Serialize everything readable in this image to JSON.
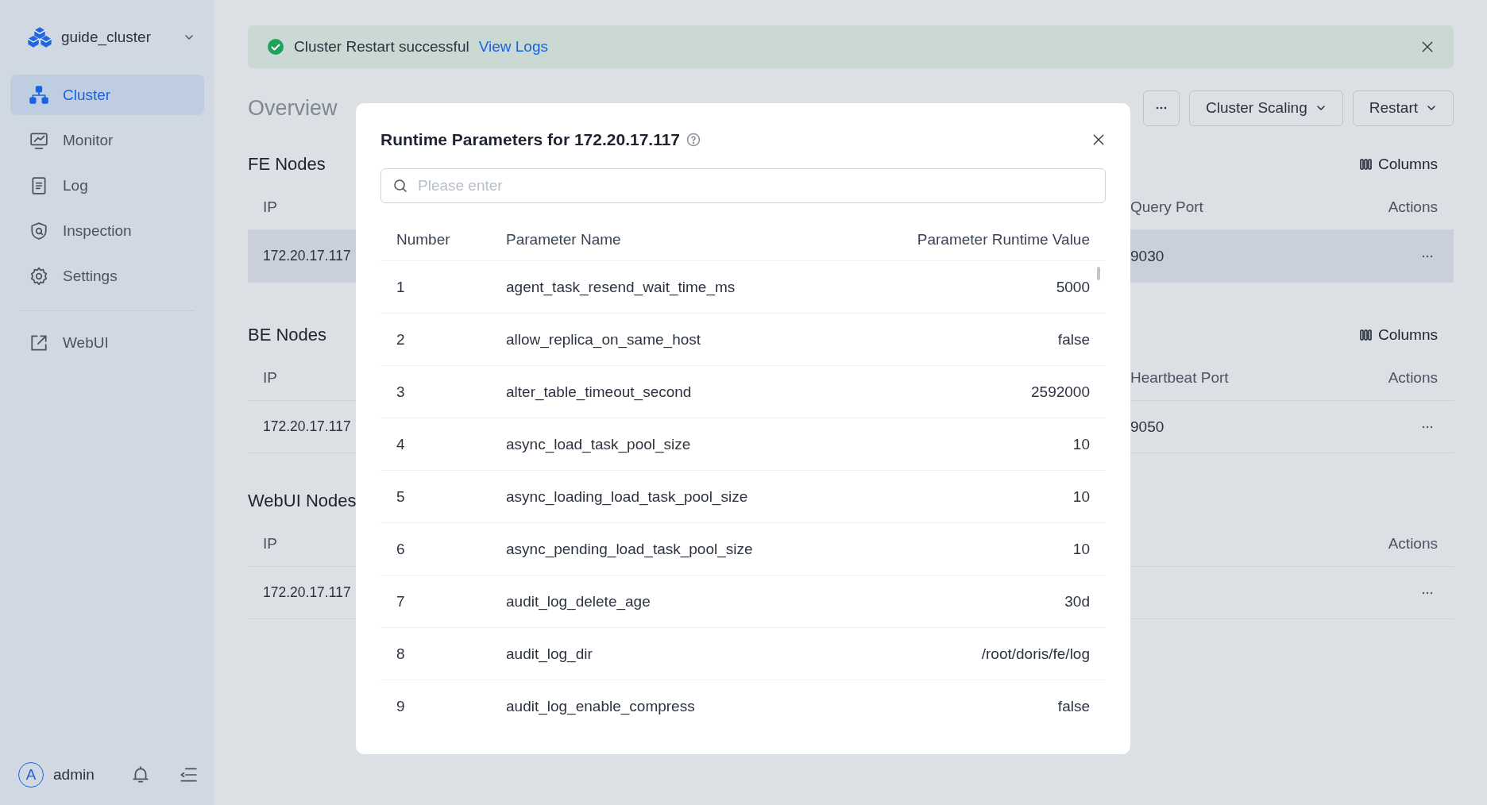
{
  "sidebar": {
    "cluster_name": "guide_cluster",
    "items": [
      {
        "label": "Cluster",
        "selected": true
      },
      {
        "label": "Monitor",
        "selected": false
      },
      {
        "label": "Log",
        "selected": false
      },
      {
        "label": "Inspection",
        "selected": false
      },
      {
        "label": "Settings",
        "selected": false
      }
    ],
    "links": [
      {
        "label": "WebUI"
      }
    ],
    "user": {
      "avatar": "A",
      "name": "admin"
    }
  },
  "notification": {
    "message": "Cluster Restart successful",
    "link": "View Logs"
  },
  "tabs": [
    {
      "label": "Overview",
      "selected": false
    }
  ],
  "toolbar": [
    {
      "kind": "more"
    },
    {
      "kind": "dropdown",
      "label": "Cluster Scaling"
    },
    {
      "kind": "dropdown",
      "label": "Restart"
    }
  ],
  "sections": [
    {
      "title": "FE Nodes",
      "columns_button": "Columns",
      "columns": [
        "IP",
        "Query Port",
        "Actions"
      ],
      "rows": [
        {
          "cells": [
            "172.20.17.117",
            "9030"
          ],
          "hovered": true
        }
      ]
    },
    {
      "title": "BE Nodes",
      "columns_button": "Columns",
      "columns": [
        "IP",
        "Heartbeat Port",
        "Actions"
      ],
      "rows": [
        {
          "cells": [
            "172.20.17.117",
            "9050"
          ],
          "hovered": false
        }
      ]
    },
    {
      "title": "WebUI Nodes",
      "columns": [
        "IP",
        "Actions"
      ],
      "rows": [
        {
          "cells": [
            "172.20.17.117"
          ],
          "hovered": false
        }
      ]
    }
  ],
  "modal": {
    "title": "Runtime Parameters for 172.20.17.117",
    "search": {
      "placeholder": "Please enter"
    },
    "columns": [
      "Number",
      "Parameter Name",
      "Parameter Runtime Value"
    ],
    "rows": [
      [
        "1",
        "agent_task_resend_wait_time_ms",
        "5000"
      ],
      [
        "2",
        "allow_replica_on_same_host",
        "false"
      ],
      [
        "3",
        "alter_table_timeout_second",
        "2592000"
      ],
      [
        "4",
        "async_load_task_pool_size",
        "10"
      ],
      [
        "5",
        "async_loading_load_task_pool_size",
        "10"
      ],
      [
        "6",
        "async_pending_load_task_pool_size",
        "10"
      ],
      [
        "7",
        "audit_log_delete_age",
        "30d"
      ],
      [
        "8",
        "audit_log_dir",
        "/root/doris/fe/log"
      ],
      [
        "9",
        "audit_log_enable_compress",
        "false"
      ]
    ]
  }
}
